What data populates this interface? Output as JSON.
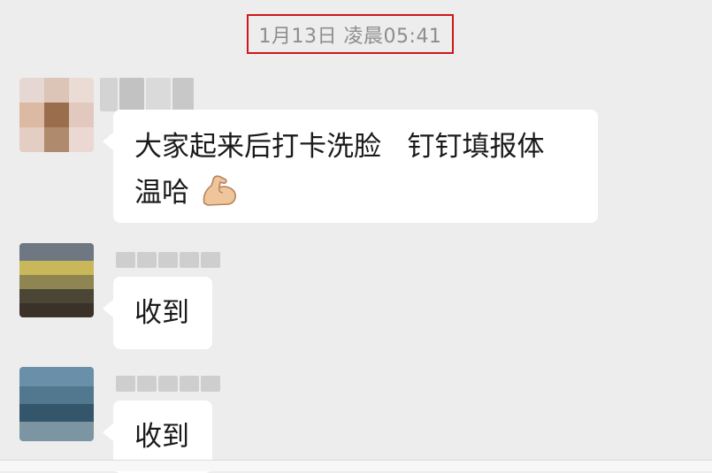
{
  "timestamp": "1月13日 凌晨05:41",
  "messages": [
    {
      "text": "大家起来后打卡洗脸   钉钉填报体\n温哈",
      "emoji": "flexed-biceps-icon"
    },
    {
      "text": "收到"
    },
    {
      "text": "收到"
    }
  ],
  "colors": {
    "highlight_border": "#d0161b",
    "background": "#ededed",
    "bubble": "#ffffff"
  }
}
